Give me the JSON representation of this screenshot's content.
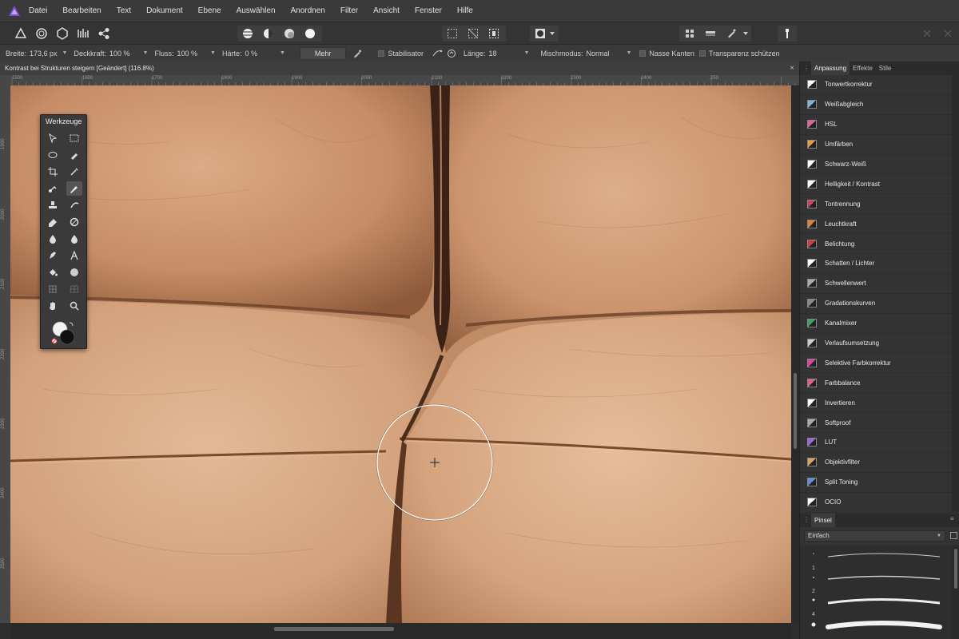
{
  "menu": [
    "Datei",
    "Bearbeiten",
    "Text",
    "Dokument",
    "Ebene",
    "Auswählen",
    "Anordnen",
    "Filter",
    "Ansicht",
    "Fenster",
    "Hilfe"
  ],
  "context": {
    "breite_label": "Breite:",
    "breite_value": "173,6 px",
    "deckkraft_label": "Deckkraft:",
    "deckkraft_value": "100 %",
    "fluss_label": "Fluss:",
    "fluss_value": "100 %",
    "haerte_label": "Härte:",
    "haerte_value": "0 %",
    "mehr_label": "Mehr",
    "stabilisator_label": "Stabilisator",
    "laenge_label": "Länge:",
    "laenge_value": "18",
    "mischmodus_label": "Mischmodus:",
    "mischmodus_value": "Normal",
    "nasse_kanten_label": "Nasse Kanten",
    "transparenz_label": "Transparenz schützen"
  },
  "document": {
    "title": "Kontrast bei Strukturen steigern [Geändert] (116.8%)",
    "close": "×"
  },
  "ruler_top": [
    "1500",
    "1600",
    "1700",
    "1800",
    "1900",
    "2000",
    "2100",
    "2200",
    "2300",
    "2400",
    "250"
  ],
  "ruler_left": [
    "1900",
    "2000",
    "2100",
    "2200",
    "2300",
    "2400",
    "2500"
  ],
  "tools_panel": {
    "title": "Werkzeuge"
  },
  "right_panel": {
    "tabs": [
      "Anpassung",
      "Effekte",
      "Stile"
    ],
    "adjustments": [
      {
        "label": "Tonwertkorrektur",
        "color": "#ffffff"
      },
      {
        "label": "Weißabgleich",
        "color": "#7fb0e0"
      },
      {
        "label": "HSL",
        "color": "#e060a0"
      },
      {
        "label": "Umfärben",
        "color": "#e0a040"
      },
      {
        "label": "Schwarz-Weiß",
        "color": "#ffffff"
      },
      {
        "label": "Helligkeit / Kontrast",
        "color": "#ffffff"
      },
      {
        "label": "Tontrennung",
        "color": "#d04060"
      },
      {
        "label": "Leuchtkraft",
        "color": "#e08030"
      },
      {
        "label": "Belichtung",
        "color": "#d04040"
      },
      {
        "label": "Schatten / Lichter",
        "color": "#ffffff"
      },
      {
        "label": "Schwellenwert",
        "color": "#aaaaaa"
      },
      {
        "label": "Gradationskurven",
        "color": "#888888"
      },
      {
        "label": "Kanalmixer",
        "color": "#40a060"
      },
      {
        "label": "Verlaufsumsetzung",
        "color": "#cccccc"
      },
      {
        "label": "Selektive Farbkorrektur",
        "color": "#e040a0"
      },
      {
        "label": "Farbbalance",
        "color": "#e06080"
      },
      {
        "label": "Invertieren",
        "color": "#ffffff"
      },
      {
        "label": "Softproof",
        "color": "#aaaaaa"
      },
      {
        "label": "LUT",
        "color": "#a060e0"
      },
      {
        "label": "Objektivfilter",
        "color": "#e0a060"
      },
      {
        "label": "Split Toning",
        "color": "#6090d0"
      },
      {
        "label": "OCIO",
        "color": "#ffffff"
      }
    ],
    "pinsel_tab": "Pinsel",
    "pinsel_category": "Einfach",
    "brush_sizes": [
      "1",
      "2",
      "4"
    ]
  }
}
